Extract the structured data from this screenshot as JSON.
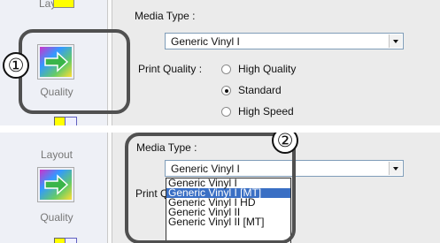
{
  "top": {
    "sidebar": {
      "layout_label": "Layout",
      "quality_label": "Quality"
    },
    "media_type_label": "Media Type :",
    "media_type_value": "Generic Vinyl I",
    "print_quality_label": "Print Quality :",
    "quality_options": [
      {
        "label": "High Quality",
        "checked": false
      },
      {
        "label": "Standard",
        "checked": true
      },
      {
        "label": "High Speed",
        "checked": false
      }
    ],
    "callout_number": "①"
  },
  "bottom": {
    "sidebar": {
      "layout_label": "Layout",
      "quality_label": "Quality"
    },
    "media_type_label": "Media Type :",
    "media_type_value": "Generic Vinyl I",
    "print_quality_label": "Print Q",
    "dropdown_options": [
      {
        "label": "Generic Vinyl I",
        "selected": false
      },
      {
        "label": "Generic Vinyl I [MT]",
        "selected": true
      },
      {
        "label": "Generic Vinyl I HD",
        "selected": false
      },
      {
        "label": "Generic Vinyl II",
        "selected": false
      },
      {
        "label": "Generic Vinyl II [MT]",
        "selected": false
      }
    ],
    "callout_number": "②"
  },
  "colors": {
    "selection": "#3a6fc4",
    "callout_ring": "#505050",
    "sidebar_bg": "#eef0f6",
    "dialog_bg": "#ebebeb"
  }
}
